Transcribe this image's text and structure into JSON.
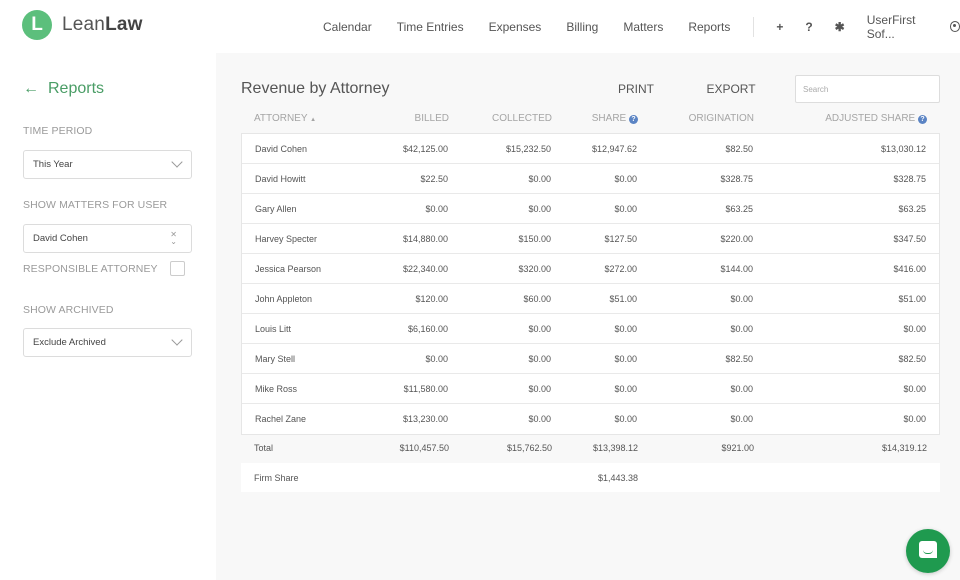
{
  "app": {
    "logo_letter": "L",
    "logo_text_light": "Lean",
    "logo_text_bold": "Law",
    "brand_color": "#5cbf7c"
  },
  "nav": {
    "items": [
      "Calendar",
      "Time Entries",
      "Expenses",
      "Billing",
      "Matters",
      "Reports"
    ],
    "plus_icon": "+",
    "help_icon": "?",
    "gear_icon": "✱",
    "user_label": "UserFirst Sof..."
  },
  "sidebar": {
    "back_label": "Reports",
    "time_period_label": "TIME PERIOD",
    "time_period_value": "This Year",
    "show_matters_label": "SHOW MATTERS FOR USER",
    "user_value": "David Cohen",
    "responsible_label": "RESPONSIBLE ATTORNEY",
    "responsible_checked": false,
    "show_archived_label": "SHOW ARCHIVED",
    "archived_value": "Exclude Archived"
  },
  "main": {
    "title": "Revenue by Attorney",
    "print_label": "PRINT",
    "export_label": "EXPORT",
    "search_placeholder": "Search",
    "columns": {
      "attorney": "ATTORNEY",
      "billed": "BILLED",
      "collected": "COLLECTED",
      "share": "SHARE",
      "origination": "ORIGINATION",
      "adjusted": "ADJUSTED SHARE"
    },
    "sort_indicator": "▲",
    "rows": [
      {
        "name": "David Cohen",
        "billed": "$42,125.00",
        "collected": "$15,232.50",
        "share": "$12,947.62",
        "origination": "$82.50",
        "adjusted": "$13,030.12"
      },
      {
        "name": "David Howitt",
        "billed": "$22.50",
        "collected": "$0.00",
        "share": "$0.00",
        "origination": "$328.75",
        "adjusted": "$328.75"
      },
      {
        "name": "Gary Allen",
        "billed": "$0.00",
        "collected": "$0.00",
        "share": "$0.00",
        "origination": "$63.25",
        "adjusted": "$63.25"
      },
      {
        "name": "Harvey Specter",
        "billed": "$14,880.00",
        "collected": "$150.00",
        "share": "$127.50",
        "origination": "$220.00",
        "adjusted": "$347.50"
      },
      {
        "name": "Jessica Pearson",
        "billed": "$22,340.00",
        "collected": "$320.00",
        "share": "$272.00",
        "origination": "$144.00",
        "adjusted": "$416.00"
      },
      {
        "name": "John Appleton",
        "billed": "$120.00",
        "collected": "$60.00",
        "share": "$51.00",
        "origination": "$0.00",
        "adjusted": "$51.00"
      },
      {
        "name": "Louis Litt",
        "billed": "$6,160.00",
        "collected": "$0.00",
        "share": "$0.00",
        "origination": "$0.00",
        "adjusted": "$0.00"
      },
      {
        "name": "Mary Stell",
        "billed": "$0.00",
        "collected": "$0.00",
        "share": "$0.00",
        "origination": "$82.50",
        "adjusted": "$82.50"
      },
      {
        "name": "Mike Ross",
        "billed": "$11,580.00",
        "collected": "$0.00",
        "share": "$0.00",
        "origination": "$0.00",
        "adjusted": "$0.00"
      },
      {
        "name": "Rachel Zane",
        "billed": "$13,230.00",
        "collected": "$0.00",
        "share": "$0.00",
        "origination": "$0.00",
        "adjusted": "$0.00"
      }
    ],
    "total": {
      "name": "Total",
      "billed": "$110,457.50",
      "collected": "$15,762.50",
      "share": "$13,398.12",
      "origination": "$921.00",
      "adjusted": "$14,319.12"
    },
    "firm_share": {
      "name": "Firm Share",
      "share": "$1,443.38"
    }
  }
}
